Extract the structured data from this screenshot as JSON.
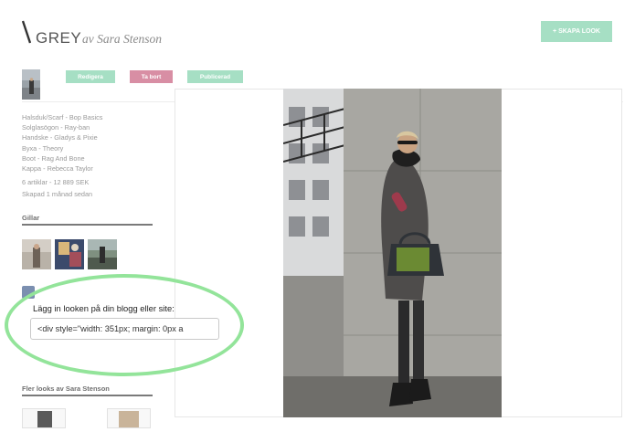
{
  "header": {
    "logo_text": "GREY",
    "byline": "av Sara Stenson",
    "create_button": "+ SKAPA LOOK"
  },
  "actions": {
    "edit": "Redigera",
    "delete": "Ta bort",
    "publish": "Publicerad"
  },
  "look": {
    "items": [
      "Halsduk/Scarf - Bop Basics",
      "Solglasögon - Ray-ban",
      "Handske - Gladys & Pixie",
      "Byxa - Theory",
      "Boot - Rag And Bone",
      "Kappa - Rebecca Taylor"
    ],
    "stats": "6 artiklar - 12 889 SEK",
    "created": "Skapad 1 månad sedan"
  },
  "likes": {
    "title": "Gillar"
  },
  "embed": {
    "label": "Lägg in looken på din blogg eller site:",
    "value": "<div style=\"width: 351px; margin: 0px a"
  },
  "more_looks": {
    "title": "Fler looks av Sara Stenson"
  },
  "colors": {
    "mint": "#a6dfc4",
    "pink": "#d88ea4",
    "highlight": "#93e49a"
  }
}
